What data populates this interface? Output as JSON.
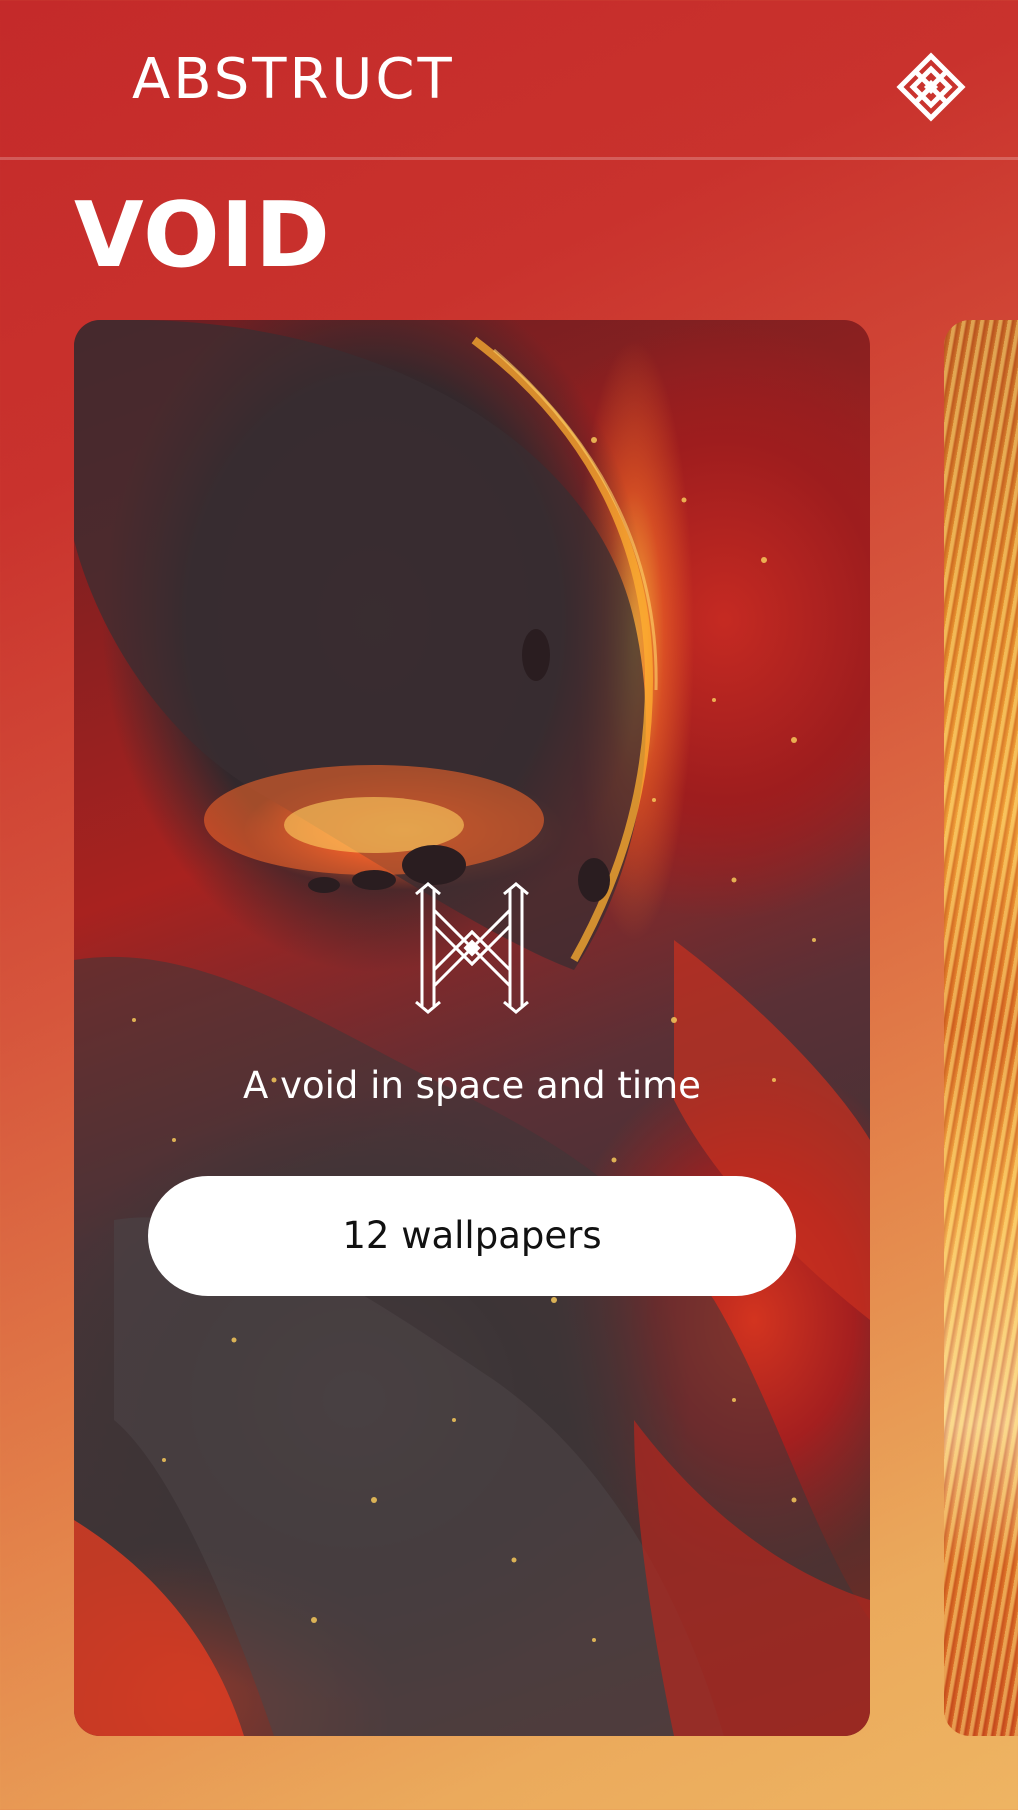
{
  "header": {
    "app_title": "ABSTRUCT",
    "menu_icon": "diamond-lattice-icon"
  },
  "collection": {
    "title": "VOID",
    "subtitle": "A void in space and time",
    "logo_icon": "abstruct-monogram-icon",
    "wallpapers_button": "12 wallpapers"
  },
  "colors": {
    "background_top": "#c42a2a",
    "background_bottom": "#eeb462",
    "button_bg": "#ffffff",
    "button_text": "#111111",
    "text": "#ffffff"
  }
}
